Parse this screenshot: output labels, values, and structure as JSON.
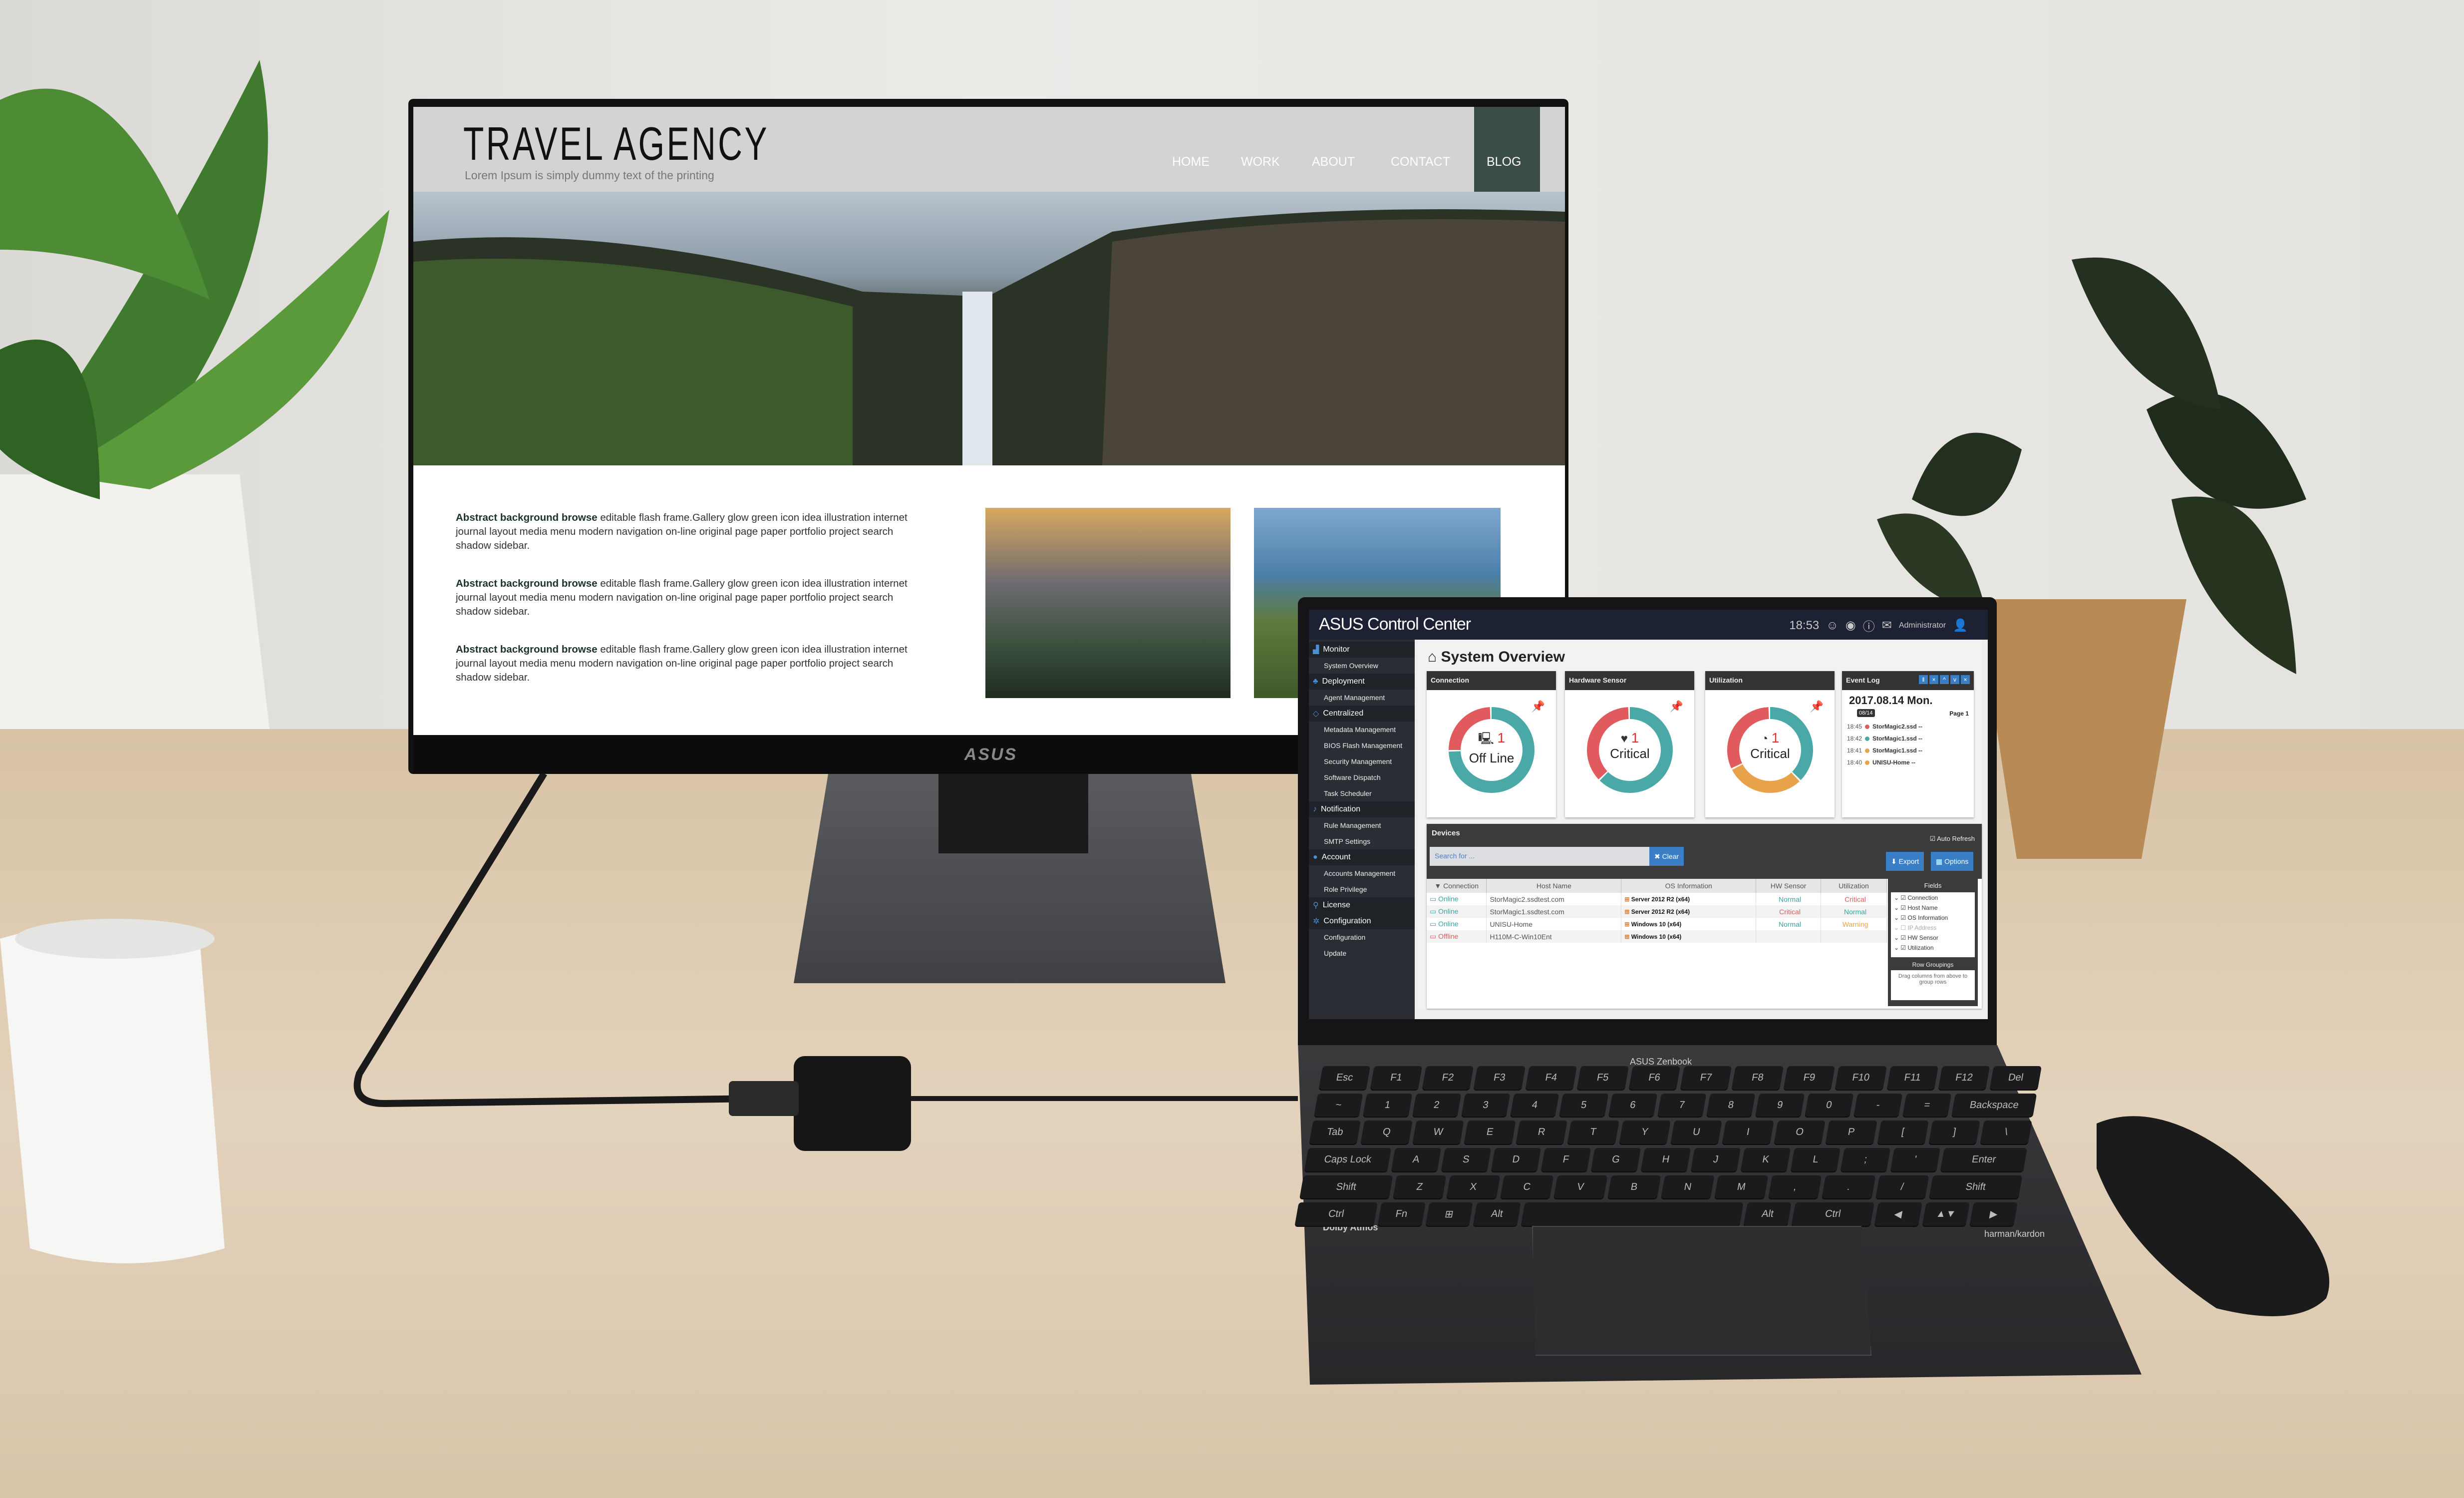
{
  "monitor": {
    "brand_logo": "ASUS",
    "website": {
      "title": "TRAVEL AGENCY",
      "subtitle": "Lorem Ipsum is simply dummy text of the printing",
      "nav": [
        "HOME",
        "WORK",
        "ABOUT",
        "CONTACT",
        "BLOG"
      ],
      "active_nav": "BLOG",
      "accent_color": "#3b4d48",
      "paragraphs": [
        {
          "bold": "Abstract background browse",
          "text": "editable flash frame.Gallery glow green icon idea illustration internet journal layout media menu modern navigation on-line original page paper portfolio project search shadow sidebar."
        },
        {
          "bold": "Abstract background browse",
          "text": "editable flash frame.Gallery glow green icon idea illustration internet journal layout media menu modern navigation on-line original page paper portfolio project search shadow sidebar."
        },
        {
          "bold": "Abstract background browse",
          "text": "editable flash frame.Gallery glow green icon idea illustration internet journal layout media menu modern navigation on-line original page paper portfolio project search shadow sidebar."
        }
      ]
    }
  },
  "laptop": {
    "model_label": "ASUS Zenbook",
    "dolby_label": "Dolby Atmos",
    "speaker_label": "harman/kardon",
    "keyboard_rows": [
      [
        "Esc",
        "F1",
        "F2",
        "F3",
        "F4",
        "F5",
        "F6",
        "F7",
        "F8",
        "F9",
        "F10",
        "F11",
        "F12",
        "Del"
      ],
      [
        "~",
        "1",
        "2",
        "3",
        "4",
        "5",
        "6",
        "7",
        "8",
        "9",
        "0",
        "-",
        "=",
        "Backspace"
      ],
      [
        "Tab",
        "Q",
        "W",
        "E",
        "R",
        "T",
        "Y",
        "U",
        "I",
        "O",
        "P",
        "[",
        "]",
        "\\"
      ],
      [
        "Caps Lock",
        "A",
        "S",
        "D",
        "F",
        "G",
        "H",
        "J",
        "K",
        "L",
        ";",
        "'",
        "Enter"
      ],
      [
        "Shift",
        "Z",
        "X",
        "C",
        "V",
        "B",
        "N",
        "M",
        ",",
        ".",
        "/",
        "Shift"
      ],
      [
        "Ctrl",
        "Fn",
        "⊞",
        "Alt",
        "",
        "Alt",
        "Ctrl",
        "◀",
        "▲▼",
        "▶"
      ]
    ],
    "app": {
      "title": "ASUS Control Center",
      "time": "18:53",
      "user": "Administrator",
      "sidebar": [
        {
          "label": "Monitor",
          "category": true,
          "icon": "chart-icon"
        },
        {
          "label": "System Overview"
        },
        {
          "label": "Deployment",
          "category": true,
          "icon": "sitemap-icon"
        },
        {
          "label": "Agent Management"
        },
        {
          "label": "Centralized",
          "category": true,
          "icon": "diamond-icon"
        },
        {
          "label": "Metadata Management"
        },
        {
          "label": "BIOS Flash Management"
        },
        {
          "label": "Security Management"
        },
        {
          "label": "Software Dispatch"
        },
        {
          "label": "Task Scheduler"
        },
        {
          "label": "Notification",
          "category": true,
          "icon": "bell-icon"
        },
        {
          "label": "Rule Management"
        },
        {
          "label": "SMTP Settings"
        },
        {
          "label": "Account",
          "category": true,
          "icon": "user-icon"
        },
        {
          "label": "Accounts Management"
        },
        {
          "label": "Role Privilege"
        },
        {
          "label": "License",
          "category": true,
          "icon": "key-icon"
        },
        {
          "label": "Configuration",
          "category": true,
          "icon": "gear-icon"
        },
        {
          "label": "Configuration"
        },
        {
          "label": "Update"
        }
      ],
      "overview_title": "System Overview",
      "cards": [
        {
          "title": "Connection",
          "count": "1",
          "status": "Off Line",
          "segments": [
            {
              "color": "#e05a5e",
              "fraction": 0.25
            },
            {
              "color": "#4aa8a6",
              "fraction": 0.75
            }
          ]
        },
        {
          "title": "Hardware Sensor",
          "count": "1",
          "status": "Critical",
          "segments": [
            {
              "color": "#e05a5e",
              "fraction": 0.37
            },
            {
              "color": "#4aa8a6",
              "fraction": 0.63
            }
          ]
        },
        {
          "title": "Utilization",
          "count": "1",
          "status": "Critical",
          "segments": [
            {
              "color": "#e05a5e",
              "fraction": 0.32
            },
            {
              "color": "#e8a34a",
              "fraction": 0.3
            },
            {
              "color": "#4aa8a6",
              "fraction": 0.38
            }
          ]
        }
      ],
      "event_log": {
        "title": "Event Log",
        "date": "2017.08.14 Mon.",
        "badge": "08/14",
        "page": "Page 1",
        "entries": [
          {
            "time": "18:45",
            "host": "StorMagic2.ssd --",
            "color": "#e05a5e"
          },
          {
            "time": "18:42",
            "host": "StorMagic1.ssd --",
            "color": "#4aa8a6"
          },
          {
            "time": "18:41",
            "host": "StorMagic1.ssd --",
            "color": "#e8a34a"
          },
          {
            "time": "18:40",
            "host": "UNISU-Home --",
            "color": "#e8a34a"
          }
        ]
      },
      "devices": {
        "title": "Devices",
        "auto_refresh": "Auto Refresh",
        "search_placeholder": "Search for ...",
        "clear": "✖ Clear",
        "export": "⬇ Export",
        "options": "▦ Options",
        "columns": [
          "▼ Connection",
          "Host Name",
          "OS Information",
          "HW Sensor",
          "Utilization"
        ],
        "rows": [
          {
            "connection": "Online",
            "host": "StorMagic2.ssdtest.com",
            "os": "Server 2012 R2 (x64)",
            "hw": "Normal",
            "util": "Critical"
          },
          {
            "connection": "Online",
            "host": "StorMagic1.ssdtest.com",
            "os": "Server 2012 R2 (x64)",
            "hw": "Critical",
            "util": "Normal"
          },
          {
            "connection": "Online",
            "host": "UNISU-Home",
            "os": "Windows 10 (x64)",
            "hw": "Normal",
            "util": "Warning"
          },
          {
            "connection": "Offline",
            "host": "H110M-C-Win10Ent",
            "os": "Windows 10 (x64)",
            "hw": "",
            "util": ""
          }
        ],
        "status_colors": {
          "Online": "#3aa6a0",
          "Offline": "#e05a5e",
          "Normal": "#3aa6a0",
          "Critical": "#e05a5e",
          "Warning": "#e8a34a"
        },
        "fields_title": "Fields",
        "fields": [
          {
            "label": "Connection",
            "checked": true
          },
          {
            "label": "Host Name",
            "checked": true
          },
          {
            "label": "OS Information",
            "checked": true
          },
          {
            "label": "IP Address",
            "checked": false
          },
          {
            "label": "HW Sensor",
            "checked": true
          },
          {
            "label": "Utilization",
            "checked": true
          }
        ],
        "row_groupings_title": "Row Groupings",
        "row_groupings_hint": "Drag columns from above to group rows"
      }
    }
  }
}
